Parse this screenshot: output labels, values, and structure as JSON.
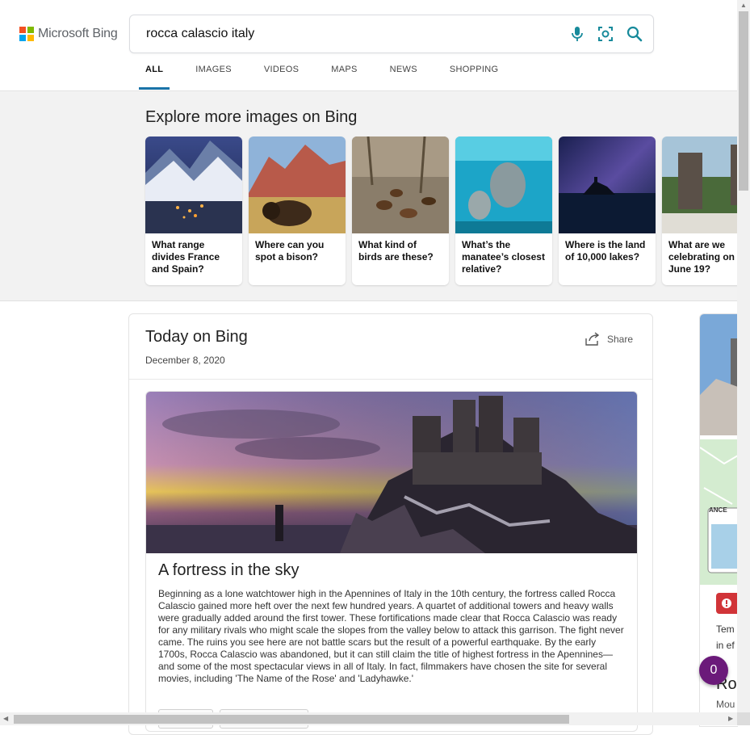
{
  "logo": {
    "text": "Microsoft Bing",
    "colors": [
      "#f25022",
      "#7fba00",
      "#00a4ef",
      "#ffb900"
    ]
  },
  "search": {
    "query": "rocca calascio italy"
  },
  "icons": {
    "mic": "microphone-icon",
    "visual": "visual-search-icon",
    "search": "search-icon",
    "share": "share-icon"
  },
  "tabs": [
    {
      "label": "ALL",
      "active": true
    },
    {
      "label": "IMAGES"
    },
    {
      "label": "VIDEOS"
    },
    {
      "label": "MAPS"
    },
    {
      "label": "NEWS"
    },
    {
      "label": "SHOPPING"
    }
  ],
  "explore": {
    "title": "Explore more images on Bing",
    "cards": [
      {
        "label": "What range divides France and Spain?"
      },
      {
        "label": "Where can you spot a bison?"
      },
      {
        "label": "What kind of birds are these?"
      },
      {
        "label": "What’s the manatee’s closest relative?"
      },
      {
        "label": "Where is the land of 10,000 lakes?"
      },
      {
        "label": "What are we celebrating on June 19?"
      }
    ]
  },
  "today": {
    "title": "Today on Bing",
    "date": "December 8, 2020",
    "share_label": "Share",
    "article_title": "A fortress in the sky",
    "article_body": "Beginning as a lone watchtower high in the Apennines of Italy in the 10th century, the fortress called Rocca Calascio gained more heft over the next few hundred years. A quartet of additional towers and heavy walls were gradually added around the first tower. These fortifications made clear that Rocca Calascio was ready for any military rivals who might scale the slopes from the valley below to attack this garrison. The fight never came. The ruins you see here are not battle scars but the result of a powerful earthquake. By the early 1700s, Rocca Calascio was abandoned, but it can still claim the title of highest fortress in the Apennines—and some of the most spectacular views in all of Italy. In fact, filmmakers have chosen the site for several movies, including 'The Name of the Rose' and 'Ladyhawke.'"
  },
  "right_column": {
    "map_label": "ANCE",
    "alert_text_1": "Tem",
    "alert_text_2": "in ef",
    "heading_fragment": "Ro",
    "sub_fragment": "Mou"
  },
  "notification_count": "0",
  "colors": {
    "accent": "#1a73a8",
    "badge": "#6b1a7a",
    "alert": "#d13438",
    "icon_teal": "#178a9b"
  }
}
